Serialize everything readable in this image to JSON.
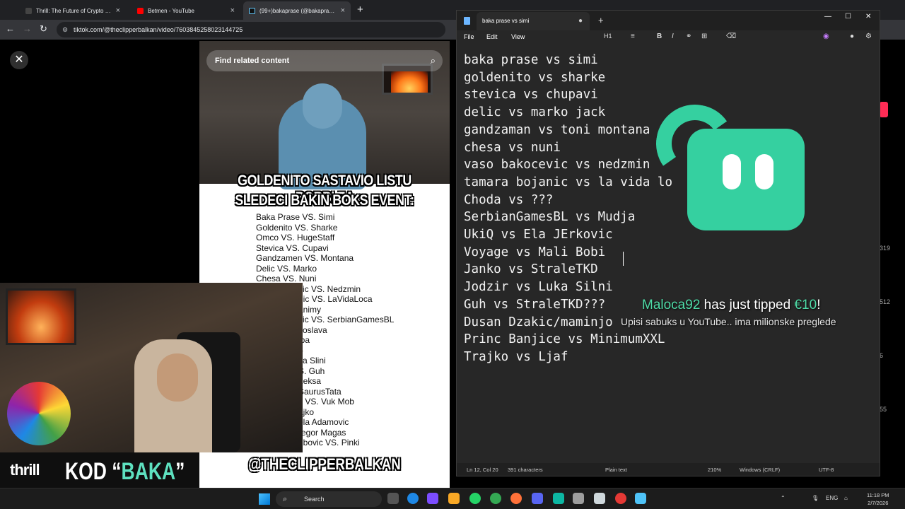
{
  "browser": {
    "tabs": [
      {
        "title": "Thrill: The Future of Crypto Casi",
        "color": "#1f1f1f"
      },
      {
        "title": "Betmen - YouTube",
        "color": "#ff0000"
      },
      {
        "title": "(99+)bakaprase (@bakaprase) |",
        "color": "#111111"
      }
    ],
    "url": "tiktok.com/@theclipperbalkan/video/7603845258023144725"
  },
  "video": {
    "search_placeholder": "Find related content",
    "caption_line1": "GOLDENITO SASTAVIO LISTU BORBI ZA",
    "caption_line2": "SLEDECI BAKIN BOKS EVENT:",
    "fight_list": [
      "Baka Prase VS. Simi",
      "Goldenito VS. Sharke",
      "Omco VS. HugeStaff",
      "Stevica VS. Cupavi",
      "Gandzamen VS.          Montana",
      "Delic VS. Marko",
      "Chesa VS. Nuni",
      "vic VS. Nedzmin",
      "nic VS. LaVidaLoca",
      "animy",
      "vic VS. SerbianGamesBL",
      "koslava",
      "iba",
      "p",
      "ka Slini",
      "S. Guh",
      "Leksa",
      "SaurusTata",
      "c VS. Vuk Mob",
      "ajko",
      "ola Adamovic",
      "regor Magas",
      "ubovic VS. Pinki"
    ],
    "watermark": "@THECLIPPERBALKAN"
  },
  "banner": {
    "brand": "thrill",
    "kod_prefix": "KOD “",
    "kod_code": "BAKA",
    "kod_suffix": "”"
  },
  "side_counts": [
    "319",
    "512",
    "6",
    "55"
  ],
  "notepad": {
    "tab_title": "baka prase vs simi",
    "menu": [
      "File",
      "Edit",
      "View"
    ],
    "heading_tool": "H1",
    "lines": [
      "baka prase vs simi",
      "goldenito vs sharke",
      "stevica vs chupavi",
      "delic vs marko jack",
      "gandzaman vs toni montana",
      "chesa vs nuni",
      "vaso bakocevic vs nedzmin",
      "tamara bojanic vs la vida lo",
      "Choda vs ???",
      "SerbianGamesBL vs Mudja",
      "UkiQ vs Ela JErkovic",
      "Voyage vs Mali Bobi",
      "Janko vs StraleTKD",
      "Jodzir vs Luka Silni",
      "Guh vs StraleTKD???",
      "Dusan Dzakic/maminjo",
      "Princ Banjice vs MinimumXXL",
      "Trajko vs Ljaf"
    ],
    "status": {
      "position": "Ln 12, Col 20",
      "chars": "391 characters",
      "format": "Plain text",
      "zoom": "210%",
      "line_ending": "Windows (CRLF)",
      "encoding": "UTF-8"
    }
  },
  "overlay": {
    "tipper": "Maloca92",
    "tip_text": " has just tipped ",
    "amount": "€10",
    "exclaim": "!",
    "message": "Upisi sabuks u YouTube.. ima milionske preglede"
  },
  "taskbar": {
    "search": "Search",
    "lang": "ENG",
    "time": "11:18 PM",
    "date": "2/7/2026"
  }
}
